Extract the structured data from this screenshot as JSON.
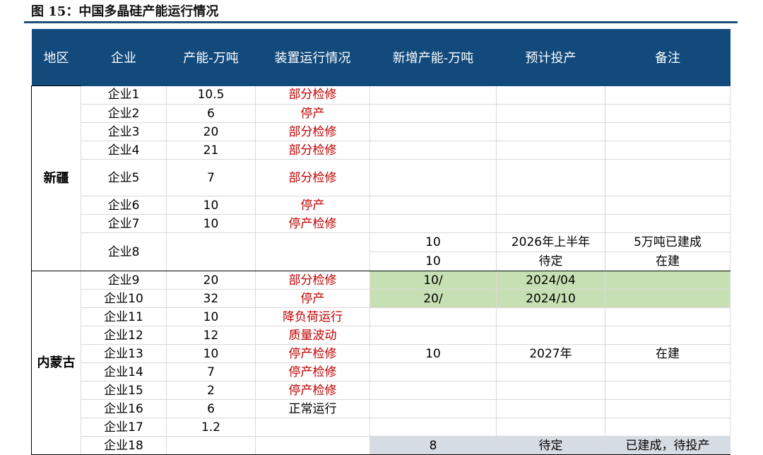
{
  "caption": "图 15：中国多晶硅产能运行情况",
  "headers": [
    "地区",
    "企业",
    "产能-万吨",
    "装置运行情况",
    "新增产能-万吨",
    "预计投产",
    "备注"
  ],
  "regions": {
    "xinjiang": "新疆",
    "neimenggu": "内蒙古"
  },
  "rows": [
    {
      "company": "企业1",
      "capacity": "10.5",
      "status": "部分检修",
      "new_capacity": "",
      "production": "",
      "note": ""
    },
    {
      "company": "企业2",
      "capacity": "6",
      "status": "停产",
      "new_capacity": "",
      "production": "",
      "note": ""
    },
    {
      "company": "企业3",
      "capacity": "20",
      "status": "部分检修",
      "new_capacity": "",
      "production": "",
      "note": ""
    },
    {
      "company": "企业4",
      "capacity": "21",
      "status": "部分检修",
      "new_capacity": "",
      "production": "",
      "note": ""
    },
    {
      "company": "企业5",
      "capacity": "7",
      "status": "部分检修",
      "new_capacity": "",
      "production": "",
      "note": ""
    },
    {
      "company": "企业6",
      "capacity": "10",
      "status": "停产",
      "new_capacity": "",
      "production": "",
      "note": ""
    },
    {
      "company": "企业7",
      "capacity": "10",
      "status": "停产检修",
      "new_capacity": "",
      "production": "",
      "note": ""
    },
    {
      "company": "企业8",
      "capacity": "",
      "status": "",
      "new_capacity": [
        "10",
        "10"
      ],
      "production": [
        "2026年上半年",
        "待定"
      ],
      "note": [
        "5万吨已建成",
        "在建"
      ]
    },
    {
      "company": "企业9",
      "capacity": "20",
      "status": "部分检修",
      "new_capacity": "10/",
      "production": "2024/04",
      "note": ""
    },
    {
      "company": "企业10",
      "capacity": "32",
      "status": "停产",
      "new_capacity": "20/",
      "production": "2024/10",
      "note": ""
    },
    {
      "company": "企业11",
      "capacity": "10",
      "status": "降负荷运行",
      "new_capacity": "",
      "production": "",
      "note": ""
    },
    {
      "company": "企业12",
      "capacity": "12",
      "status": "质量波动",
      "new_capacity": "",
      "production": "",
      "note": ""
    },
    {
      "company": "企业13",
      "capacity": "10",
      "status": "停产检修",
      "new_capacity": "10",
      "production": "2027年",
      "note": "在建"
    },
    {
      "company": "企业14",
      "capacity": "7",
      "status": "停产检修",
      "new_capacity": "",
      "production": "",
      "note": ""
    },
    {
      "company": "企业15",
      "capacity": "2",
      "status": "停产检修",
      "new_capacity": "",
      "production": "",
      "note": ""
    },
    {
      "company": "企业16",
      "capacity": "6",
      "status": "正常运行",
      "new_capacity": "",
      "production": "",
      "note": ""
    },
    {
      "company": "企业17",
      "capacity": "1.2",
      "status": "",
      "new_capacity": "",
      "production": "",
      "note": ""
    },
    {
      "company": "企业18",
      "capacity": "",
      "status": "",
      "new_capacity": "8",
      "production": "待定",
      "note": "已建成，待投产"
    }
  ],
  "colors": {
    "header_bg": "#124a7c",
    "status_red": "#c00000",
    "highlight_green": "#c6e0b4",
    "highlight_gray": "#d6dce4",
    "caption_rule": "#1f4e79"
  }
}
